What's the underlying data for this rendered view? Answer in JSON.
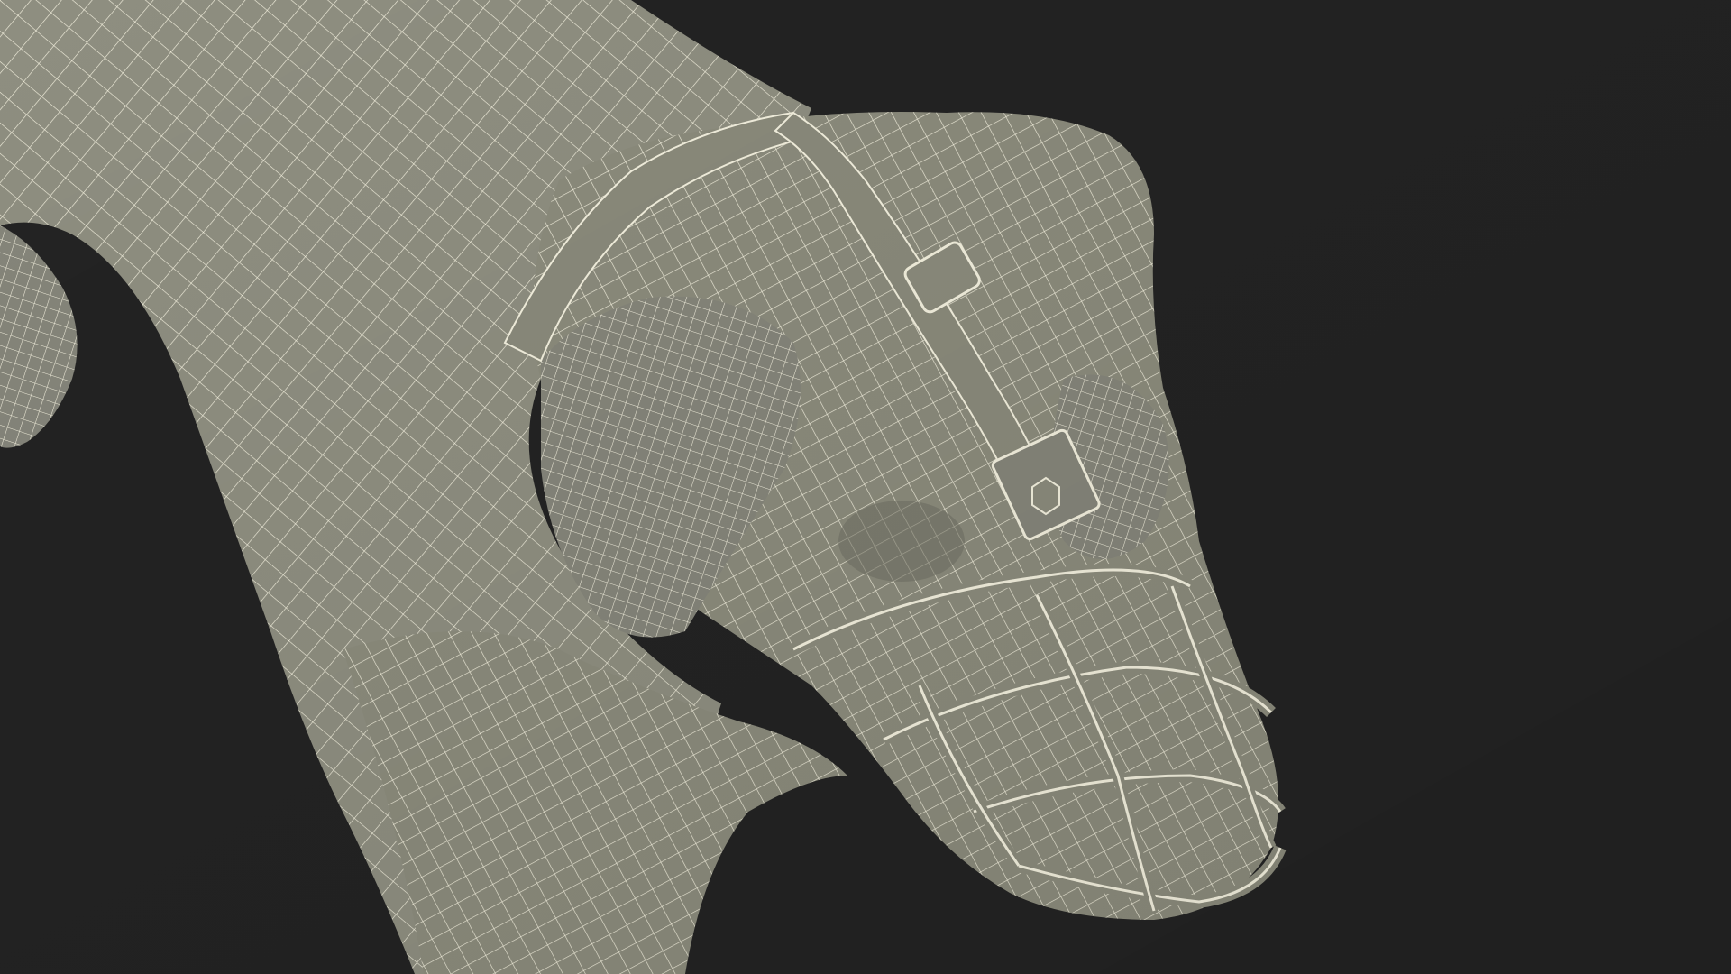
{
  "scene": {
    "background_color": "#232323",
    "mesh_fill_color": "#8b8b7c",
    "mesh_shadow_color": "#6f6f62",
    "wire_color": "#f2efdd",
    "subject": "wireframe-3d-dog-with-muzzle"
  }
}
